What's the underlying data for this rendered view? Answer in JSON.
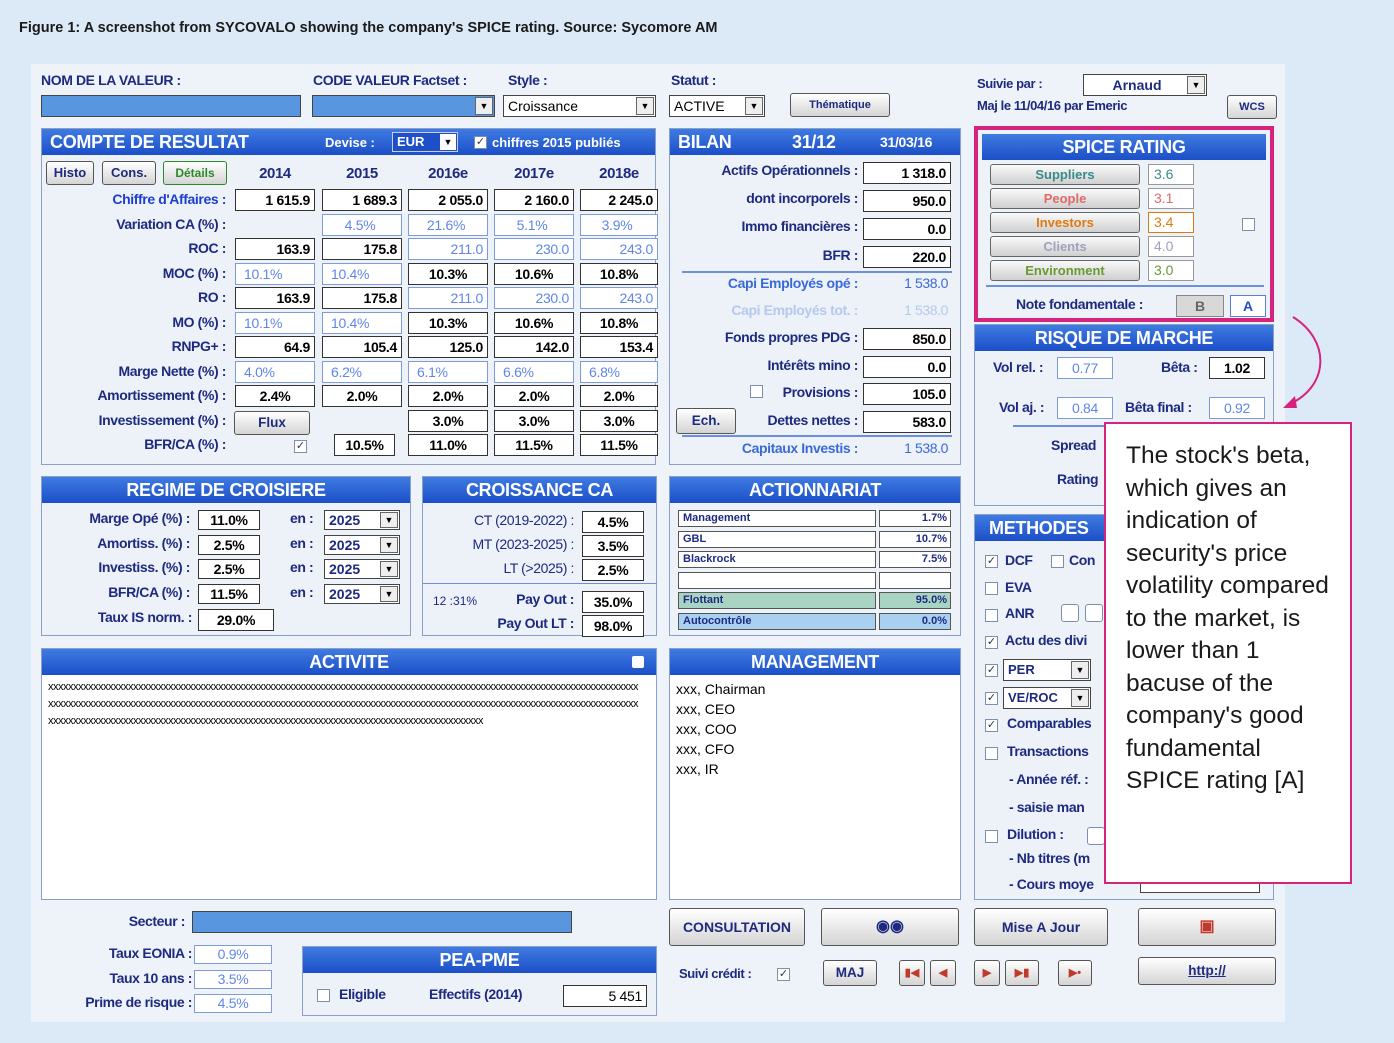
{
  "caption": "Figure 1: A screenshot from SYCOVALO showing the company's SPICE rating. Source: Sycomore AM",
  "top": {
    "nom_label": "NOM DE LA VALEUR :",
    "code_label": "CODE VALEUR Factset :",
    "style_label": "Style :",
    "style_value": "Croissance",
    "statut_label": "Statut :",
    "statut_value": "ACTIVE",
    "thematique": "Thématique",
    "suivie_label": "Suivie par :",
    "suivie_value": "Arnaud",
    "maj_text": "Maj le 11/04/16 par Emeric",
    "wcs": "WCS"
  },
  "cdr": {
    "title": "COMPTE DE RESULTAT",
    "devise_label": "Devise :",
    "devise_value": "EUR",
    "published": "chiffres 2015 publiés",
    "histo": "Histo",
    "cons": "Cons.",
    "details": "Détails",
    "flux": "Flux",
    "years": [
      "2014",
      "2015",
      "2016e",
      "2017e",
      "2018e"
    ],
    "rows": [
      {
        "label": "Chiffre d'Affaires :",
        "values": [
          "1 615.9",
          "1 689.3",
          "2 055.0",
          "2 160.0",
          "2 245.0"
        ]
      },
      {
        "label": "Variation CA (%) :",
        "values": [
          "",
          "4.5%",
          "21.6%",
          "5.1%",
          "3.9%"
        ]
      },
      {
        "label": "ROC :",
        "values": [
          "163.9",
          "175.8",
          "211.0",
          "230.0",
          "243.0"
        ]
      },
      {
        "label": "MOC (%) :",
        "values": [
          "10.1%",
          "10.4%",
          "10.3%",
          "10.6%",
          "10.8%"
        ]
      },
      {
        "label": "RO :",
        "values": [
          "163.9",
          "175.8",
          "211.0",
          "230.0",
          "243.0"
        ]
      },
      {
        "label": "MO (%) :",
        "values": [
          "10.1%",
          "10.4%",
          "10.3%",
          "10.6%",
          "10.8%"
        ]
      },
      {
        "label": "RNPG+ :",
        "values": [
          "64.9",
          "105.4",
          "125.0",
          "142.0",
          "153.4"
        ]
      },
      {
        "label": "Marge Nette (%) :",
        "values": [
          "4.0%",
          "6.2%",
          "6.1%",
          "6.6%",
          "6.8%"
        ]
      },
      {
        "label": "Amortissement (%) :",
        "values": [
          "2.4%",
          "2.0%",
          "2.0%",
          "2.0%",
          "2.0%"
        ]
      },
      {
        "label": "Investissement (%) :",
        "values": [
          "",
          "",
          "3.0%",
          "3.0%",
          "3.0%"
        ]
      },
      {
        "label": "BFR/CA (%) :",
        "values": [
          "",
          "10.5%",
          "11.0%",
          "11.5%",
          "11.5%"
        ]
      }
    ]
  },
  "bilan": {
    "title": "BILAN",
    "date1": "31/12",
    "date2": "31/03/16",
    "actifs_label": "Actifs Opérationnels :",
    "actifs": "1 318.0",
    "incorp_label": "dont incorporels :",
    "incorp": "950.0",
    "immo_label": "Immo financières :",
    "immo": "0.0",
    "bfr_label": "BFR :",
    "bfr": "220.0",
    "capi_ope_label": "Capi Employés opé :",
    "capi_ope": "1 538.0",
    "capi_tot_label": "Capi Employés tot. :",
    "capi_tot": "1 538.0",
    "fp_label": "Fonds propres PDG :",
    "fp": "850.0",
    "int_label": "Intérêts mino :",
    "int": "0.0",
    "prov_label": "Provisions :",
    "prov": "105.0",
    "ech": "Ech.",
    "dettes_label": "Dettes nettes :",
    "dettes": "583.0",
    "ci_label": "Capitaux Investis :",
    "ci": "1 538.0"
  },
  "spice": {
    "title": "SPICE RATING",
    "items": [
      {
        "label": "Suppliers",
        "value": "3.6",
        "color": "#3a8a8a"
      },
      {
        "label": "People",
        "value": "3.1",
        "color": "#e06a6a"
      },
      {
        "label": "Investors",
        "value": "3.4",
        "color": "#e07a10"
      },
      {
        "label": "Clients",
        "value": "4.0",
        "color": "#a0a0c0"
      },
      {
        "label": "Environment",
        "value": "3.0",
        "color": "#6a9a30"
      }
    ],
    "note_label": "Note fondamentale :",
    "note_b": "B",
    "note_a": "A"
  },
  "risque": {
    "title": "RISQUE DE MARCHE",
    "volrel_label": "Vol rel. :",
    "volrel": "0.77",
    "beta_label": "Bêta :",
    "beta": "1.02",
    "volaj_label": "Vol aj. :",
    "volaj": "0.84",
    "betafinal_label": "Bêta final :",
    "betafinal": "0.92",
    "spread_label": "Spread",
    "rating_label": "Rating"
  },
  "callout": "The stock's beta, which gives an indication of security's price volatility compared to the market, is lower than 1 bacuse of the company's good fundamental SPICE rating [A]",
  "methodes": {
    "title": "METHODES",
    "dcf": "DCF",
    "con": "Con",
    "eva": "EVA",
    "anr": "ANR",
    "actu": "Actu des divi",
    "per": "PER",
    "veroc": "VE/ROC",
    "comparables": "Comparables",
    "transactions": "Transactions",
    "annee": "- Année réf. :",
    "saisie": "- saisie man",
    "dilution": "Dilution :",
    "nb_titres": "- Nb titres (m",
    "cours": "- Cours moye"
  },
  "regime": {
    "title": "REGIME DE CROISIERE",
    "en": "en :",
    "rows": [
      {
        "label": "Marge Opé (%) :",
        "value": "11.0%",
        "year": "2025"
      },
      {
        "label": "Amortiss. (%) :",
        "value": "2.5%",
        "year": "2025"
      },
      {
        "label": "Investiss. (%) :",
        "value": "2.5%",
        "year": "2025"
      },
      {
        "label": "BFR/CA (%) :",
        "value": "11.5%",
        "year": "2025"
      }
    ],
    "taux_label": "Taux IS norm. :",
    "taux": "29.0%"
  },
  "croissance": {
    "title": "CROISSANCE CA",
    "ct_label": "CT (2019-2022) :",
    "ct": "4.5%",
    "mt_label": "MT (2023-2025) :",
    "mt": "3.5%",
    "lt_label": "LT (>2025) :",
    "lt": "2.5%",
    "ratio": "12 :31%",
    "payout_label": "Pay Out :",
    "payout": "35.0%",
    "payoutlt_label": "Pay Out LT :",
    "payoutlt": "98.0%"
  },
  "actionnariat": {
    "title": "ACTIONNARIAT",
    "rows": [
      {
        "name": "Management",
        "pct": "1.7%"
      },
      {
        "name": "GBL",
        "pct": "10.7%"
      },
      {
        "name": "Blackrock",
        "pct": "7.5%"
      },
      {
        "name": "",
        "pct": ""
      },
      {
        "name": "Flottant",
        "pct": "95.0%"
      },
      {
        "name": "Autocontrôle",
        "pct": "0.0%"
      }
    ]
  },
  "activite": {
    "title": "ACTIVITE",
    "lines": [
      "xxxxxxxxxxxxxxxxxxxxxxxxxxxxxxxxxxxxxxxxxxxxxxxxxxxxxxxxxxxxxxxxxxxxxxxxxxxxxxxxxxxxxxxxxxxxxxxxxxxxxxxxxxxxxxxxxxxxxx",
      "xxxxxxxxxxxxxxxxxxxxxxxxxxxxxxxxxxxxxxxxxxxxxxxxxxxxxxxxxxxxxxxxxxxxxxxxxxxxxxxxxxxxxxxxxxxxxxxxxxxxxxxxxxxxxxxxxxxxxx",
      "xxxxxxxxxxxxxxxxxxxxxxxxxxxxxxxxxxxxxxxxxxxxxxxxxxxxxxxxxxxxxxxxxxxxxxxxxxxxxxxxxxxxxxx"
    ]
  },
  "management": {
    "title": "MANAGEMENT",
    "lines": [
      "xxx, Chairman",
      "xxx, CEO",
      "xxx, COO",
      "xxx, CFO",
      "xxx, IR"
    ]
  },
  "bottom": {
    "secteur_label": "Secteur :",
    "eonia_label": "Taux EONIA :",
    "eonia": "0.9%",
    "taux10_label": "Taux 10 ans :",
    "taux10": "3.5%",
    "prime_label": "Prime de risque :",
    "prime": "4.5%",
    "pea_title": "PEA-PME",
    "eligible": "Eligible",
    "effectifs_label": "Effectifs (2014)",
    "effectifs": "5 451",
    "consultation": "CONSULTATION",
    "mise_a_jour": "Mise A Jour",
    "suivi_credit": "Suivi crédit :",
    "maj": "MAJ",
    "http": "http://"
  }
}
